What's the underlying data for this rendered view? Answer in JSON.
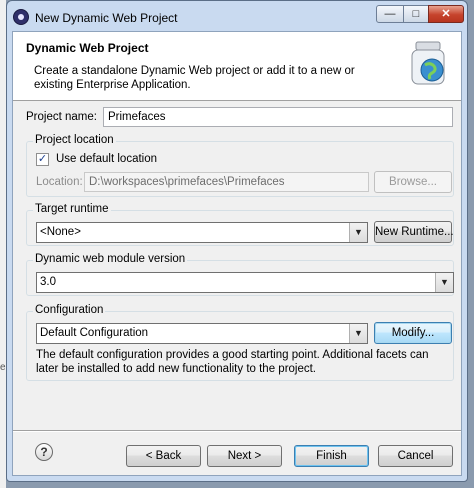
{
  "window": {
    "title": "New Dynamic Web Project",
    "icon": "eclipse-icon",
    "caption_buttons": {
      "minimize": "minimize-icon",
      "maximize": "maximize-icon",
      "close": "close-icon"
    }
  },
  "banner": {
    "title": "Dynamic Web Project",
    "description": "Create a standalone Dynamic Web project or add it to a new or existing Enterprise Application.",
    "icon": "web-project-jar-icon"
  },
  "project_name": {
    "label": "Project name:",
    "value": "Primefaces"
  },
  "project_location": {
    "group_label": "Project location",
    "use_default": {
      "label": "Use default location",
      "checked": true
    },
    "location_label": "Location:",
    "location_value": "D:\\workspaces\\primefaces\\Primefaces",
    "browse_label": "Browse..."
  },
  "target_runtime": {
    "group_label": "Target runtime",
    "selected": "<None>",
    "new_runtime_label": "New Runtime..."
  },
  "web_module": {
    "group_label": "Dynamic web module version",
    "selected": "3.0"
  },
  "configuration": {
    "group_label": "Configuration",
    "selected": "Default Configuration",
    "modify_label": "Modify...",
    "description": "The default configuration provides a good starting point. Additional facets can later be installed to add new functionality to the project."
  },
  "footer": {
    "help_icon": "help-icon",
    "back_label": "< Back",
    "next_label": "Next >",
    "finish_label": "Finish",
    "cancel_label": "Cancel"
  },
  "background": {
    "edge_glyph": "e"
  },
  "colors": {
    "title_bar": "#c9daf0",
    "close_button": "#c6432c",
    "focus_border": "#3c7fb1"
  }
}
